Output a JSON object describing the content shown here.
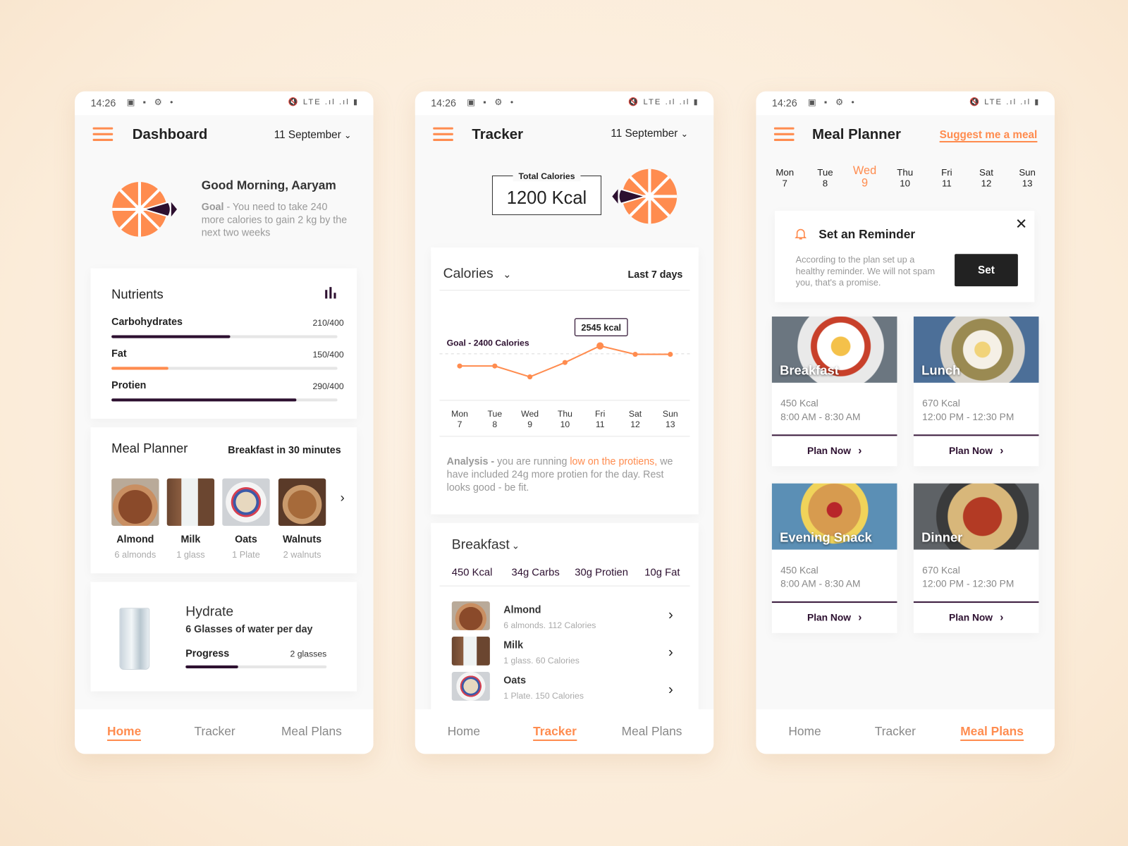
{
  "status_bar": {
    "time": "14:26",
    "left_icons": "▣ ▪ ⚙ •",
    "right_icons": "🔇 LTE .ıl .ıl ▮"
  },
  "colors": {
    "accent": "#ff8c4f",
    "dark": "#2d1030",
    "background": "#fbecd9"
  },
  "nav": {
    "home": "Home",
    "tracker": "Tracker",
    "meal_plans": "Meal Plans"
  },
  "dashboard": {
    "title": "Dashboard",
    "date": "11 September",
    "greeting": "Good Morning, Aaryam",
    "goal_label": "Goal",
    "goal_text": " - You need to take 240 more calories to gain 2 kg by the next two weeks",
    "nutrients": {
      "title": "Nutrients",
      "icon": "bar-chart-icon",
      "items": [
        {
          "label": "Carbohydrates",
          "value": "210/400",
          "progress": 0.525,
          "color": "#2d1030"
        },
        {
          "label": "Fat",
          "value": "150/400",
          "progress": 0.25,
          "color": "#ff8c4f"
        },
        {
          "label": "Protien",
          "value": "290/400",
          "progress": 0.82,
          "color": "#2d1030"
        }
      ]
    },
    "meal_planner": {
      "title": "Meal Planner",
      "next": "Breakfast in 30 minutes",
      "items": [
        {
          "name": "Almond",
          "qty": "6 almonds"
        },
        {
          "name": "Milk",
          "qty": "1 glass"
        },
        {
          "name": "Oats",
          "qty": "1 Plate"
        },
        {
          "name": "Walnuts",
          "qty": "2 walnuts"
        }
      ]
    },
    "hydrate": {
      "title": "Hydrate",
      "subtitle": "6 Glasses of water per day",
      "progress_label": "Progress",
      "progress_value": "2 glasses",
      "progress": 0.37
    }
  },
  "tracker": {
    "title": "Tracker",
    "date": "11 September",
    "total_label": "Total Calories",
    "total_value": "1200 Kcal",
    "metric": "Calories",
    "range": "Last 7 days",
    "analysis_label": "Analysis - ",
    "analysis_pre": "you are running ",
    "analysis_highlight": "low on the protiens,",
    "analysis_post": " we have included 24g more protien for the day. Rest looks good - be fit.",
    "breakfast": {
      "title": "Breakfast",
      "macros": [
        "450 Kcal",
        "34g Carbs",
        "30g Protien",
        "10g Fat"
      ],
      "items": [
        {
          "name": "Almond",
          "detail": "6 almonds. 112 Calories"
        },
        {
          "name": "Milk",
          "detail": "1 glass. 60 Calories"
        },
        {
          "name": "Oats",
          "detail": "1 Plate. 150 Calories"
        }
      ]
    }
  },
  "chart_data": {
    "type": "line",
    "categories": [
      [
        "Mon",
        "7"
      ],
      [
        "Tue",
        "8"
      ],
      [
        "Wed",
        "9"
      ],
      [
        "Thu",
        "10"
      ],
      [
        "Fri",
        "11"
      ],
      [
        "Sat",
        "12"
      ],
      [
        "Sun",
        "13"
      ]
    ],
    "values": [
      2175,
      2175,
      1975,
      2240,
      2545,
      2390,
      2390
    ],
    "goal": 2400,
    "goal_label": "Goal - 2400 Calories",
    "highlight_index": 4,
    "highlight_label": "2545 kcal",
    "ylim": [
      1550,
      3350
    ],
    "grid": false,
    "color": "#ff8c4f"
  },
  "meal_plans": {
    "title": "Meal Planner",
    "suggest": "Suggest me a meal",
    "days": [
      {
        "name": "Mon",
        "num": "7"
      },
      {
        "name": "Tue",
        "num": "8"
      },
      {
        "name": "Wed",
        "num": "9",
        "selected": true
      },
      {
        "name": "Thu",
        "num": "10"
      },
      {
        "name": "Fri",
        "num": "11"
      },
      {
        "name": "Sat",
        "num": "12"
      },
      {
        "name": "Sun",
        "num": "13"
      }
    ],
    "reminder": {
      "title": "Set an Reminder",
      "text": "According to the plan set up a healthy reminder. We will not spam you, that's a promise.",
      "button": "Set"
    },
    "meals": [
      {
        "name": "Breakfast",
        "kcal": "450 Kcal",
        "time": "8:00 AM - 8:30 AM",
        "action": "Plan Now"
      },
      {
        "name": "Lunch",
        "kcal": "670 Kcal",
        "time": "12:00 PM - 12:30 PM",
        "action": "Plan Now"
      },
      {
        "name": "Evening Snack",
        "kcal": "450 Kcal",
        "time": "8:00 AM - 8:30 AM",
        "action": "Plan Now"
      },
      {
        "name": "Dinner",
        "kcal": "670 Kcal",
        "time": "12:00 PM - 12:30 PM",
        "action": "Plan Now"
      }
    ]
  }
}
